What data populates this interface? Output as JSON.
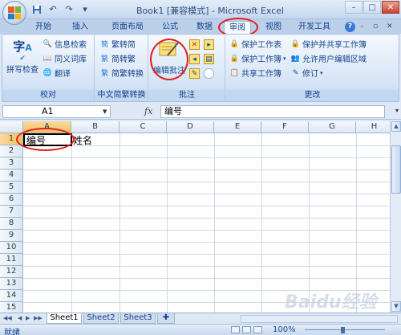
{
  "window": {
    "title": "Book1  [兼容模式] - Microsoft Excel"
  },
  "qat": {
    "icons": [
      "save-icon",
      "undo-icon",
      "redo-icon",
      "customize-icon"
    ]
  },
  "tabs": [
    {
      "label": "开始"
    },
    {
      "label": "插入"
    },
    {
      "label": "页面布局"
    },
    {
      "label": "公式"
    },
    {
      "label": "数据"
    },
    {
      "label": "审阅"
    },
    {
      "label": "视图"
    },
    {
      "label": "开发工具"
    }
  ],
  "active_tab": "审阅",
  "ribbon": {
    "proofing": {
      "label": "校对",
      "spell_check": "拼写检查",
      "research": "信息检索",
      "thesaurus": "同义词库",
      "translate": "翻译"
    },
    "chinese_conv": {
      "label": "中文简繁转换",
      "to_simplified": "繁转简",
      "to_traditional": "简转繁",
      "conversion": "简繁转换"
    },
    "comments": {
      "label": "批注",
      "edit_comment": "编辑批注"
    },
    "changes": {
      "label": "更改",
      "protect_sheet": "保护工作表",
      "protect_workbook": "保护工作簿",
      "share_workbook": "共享工作簿",
      "protect_share": "保护并共享工作簿",
      "allow_edit": "允许用户编辑区域",
      "track": "修订"
    }
  },
  "formula_bar": {
    "name_box": "A1",
    "fx": "fx",
    "content": "编号"
  },
  "columns": [
    "A",
    "B",
    "C",
    "D",
    "E",
    "F",
    "G",
    "H"
  ],
  "rows": [
    "1",
    "2",
    "3",
    "4",
    "5",
    "6",
    "7",
    "8",
    "9",
    "10",
    "11",
    "12",
    "13",
    "14",
    "15"
  ],
  "cells": {
    "A1": "编号",
    "B1": "姓名"
  },
  "sheets": [
    "Sheet1",
    "Sheet2",
    "Sheet3"
  ],
  "active_sheet": "Sheet1",
  "status": {
    "ready": "就绪",
    "zoom": "100%"
  },
  "watermark": "Baidu经验",
  "colors": {
    "highlight": "#e0201e",
    "accent": "#15428b"
  }
}
